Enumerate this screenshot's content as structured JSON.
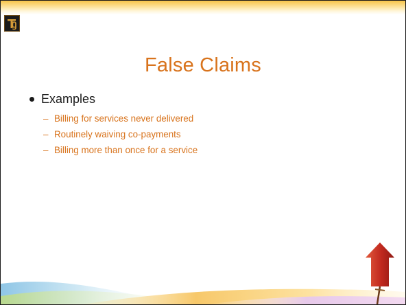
{
  "slide": {
    "title": "False Claims",
    "bullet": {
      "label": "Examples",
      "sub_items": [
        "Billing for services never delivered",
        "Routinely waiving co-payments",
        "Billing more than once for a service"
      ]
    },
    "sub_marker": "–",
    "colors": {
      "accent": "#d8731c",
      "text": "#1a1a1a",
      "band": "#f7c54a",
      "arrow": "#c0281e"
    },
    "icons": {
      "logo": "tg-logo-icon",
      "decor": "up-arrow-icon"
    }
  }
}
